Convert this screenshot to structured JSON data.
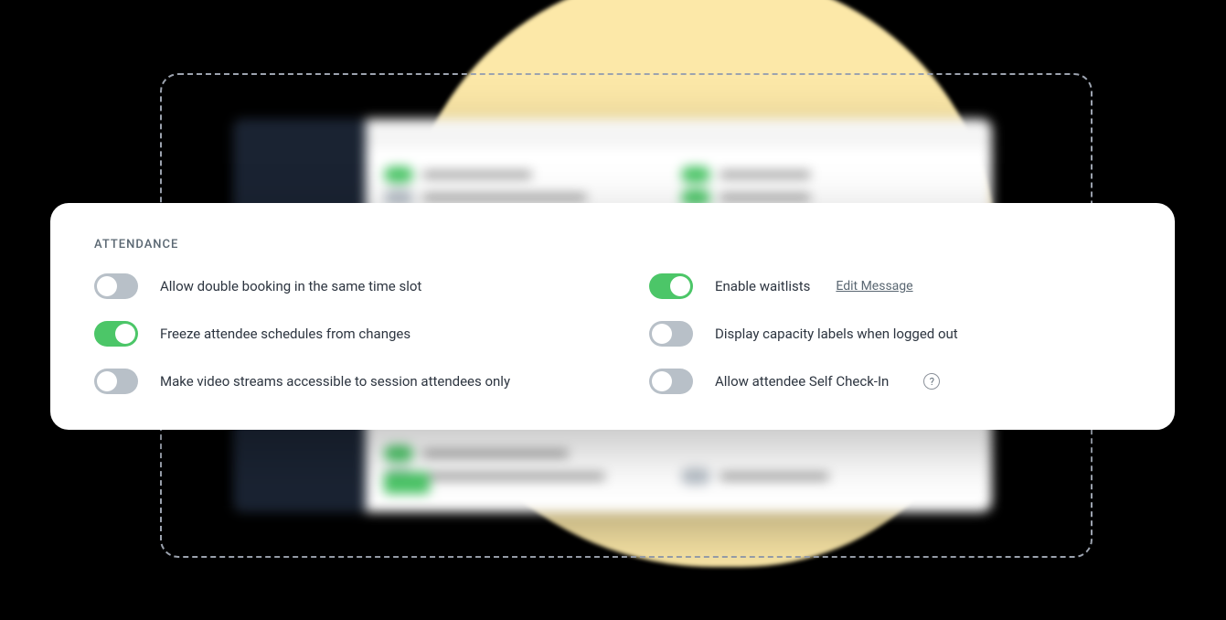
{
  "section": {
    "title": "ATTENDANCE"
  },
  "settings": {
    "left": [
      {
        "label": "Allow double booking in the same time slot",
        "enabled": false
      },
      {
        "label": "Freeze attendee schedules from changes",
        "enabled": true
      },
      {
        "label": "Make video streams accessible to session attendees only",
        "enabled": false
      }
    ],
    "right": [
      {
        "label": "Enable waitlists",
        "enabled": true,
        "link": "Edit Message"
      },
      {
        "label": "Display capacity labels when logged out",
        "enabled": false
      },
      {
        "label": "Allow attendee Self Check-In",
        "enabled": false,
        "help": "?"
      }
    ]
  }
}
